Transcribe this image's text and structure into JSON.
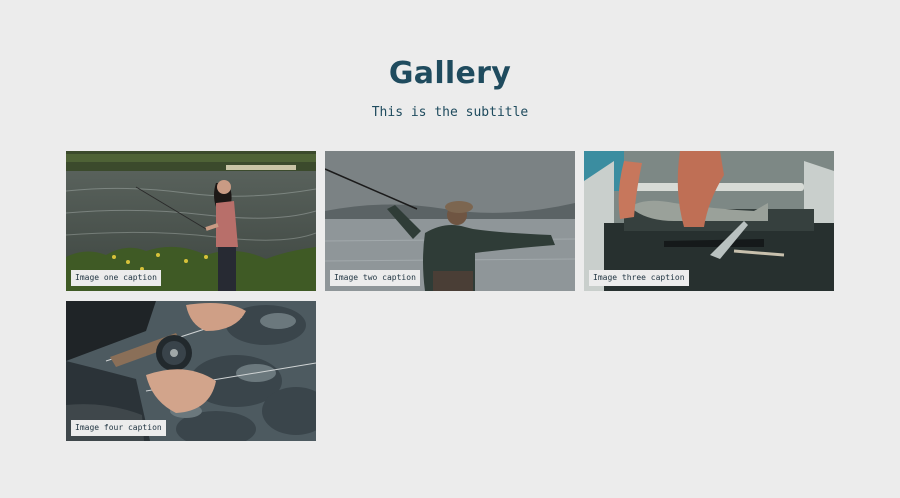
{
  "header": {
    "title": "Gallery",
    "subtitle": "This is the subtitle"
  },
  "gallery": {
    "items": [
      {
        "caption": "Image one caption",
        "photo": "woman-fishing-by-lake"
      },
      {
        "caption": "Image two caption",
        "photo": "man-casting-fly-rod"
      },
      {
        "caption": "Image three caption",
        "photo": "hands-holding-fish-in-boat"
      },
      {
        "caption": "Image four caption",
        "photo": "hands-holding-fishing-reel"
      }
    ]
  },
  "colors": {
    "background": "#ececec",
    "title": "#1f4b5e",
    "caption_bg": "#ececec"
  }
}
